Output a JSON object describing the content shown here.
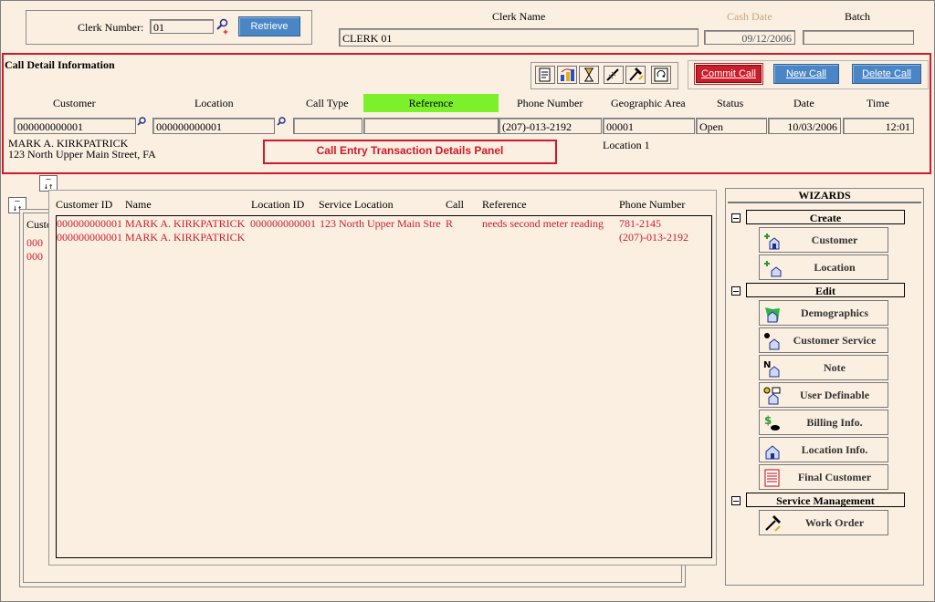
{
  "clerk": {
    "number_label": "Clerk Number:",
    "number_value": "01",
    "retrieve_label": "Retrieve",
    "name_label": "Clerk Name",
    "name_value": "CLERK 01",
    "cash_date_label": "Cash Date",
    "cash_date_value": "09/12/2006",
    "batch_label": "Batch",
    "batch_value": ""
  },
  "call_detail": {
    "title": "Call Detail Information",
    "commit_label": "Commit Call",
    "new_label": "New Call",
    "delete_label": "Delete Call",
    "headers": {
      "customer": "Customer",
      "location": "Location",
      "call_type": "Call Type",
      "reference": "Reference",
      "phone": "Phone Number",
      "geo_area": "Geographic Area",
      "status": "Status",
      "date": "Date",
      "time": "Time"
    },
    "values": {
      "customer": "000000000001",
      "location": "000000000001",
      "call_type": "",
      "reference": "",
      "phone": "(207)-013-2192",
      "geo_area": "00001",
      "status": "Open",
      "date": "10/03/2006",
      "time": "12:01"
    },
    "customer_name": "MARK A. KIRKPATRICK",
    "customer_address": "123 North Upper Main Street, FA",
    "location_desc": "Location 1",
    "panel_caption": "Call Entry Transaction Details Panel"
  },
  "grid": {
    "headers": [
      "Customer ID",
      "Name",
      "Location ID",
      "Service Location",
      "Call",
      "Reference",
      "Phone Number"
    ],
    "rows": [
      [
        "000000000001",
        "MARK A. KIRKPATRICK",
        "000000000001",
        "123 North Upper Main Stre",
        "R",
        "needs second meter reading",
        "781-2145"
      ],
      [
        "000000000001",
        "MARK A. KIRKPATRICK",
        "",
        "",
        "",
        "",
        "(207)-013-2192"
      ]
    ],
    "back_header": "Custo",
    "back_rows": [
      "000",
      "000"
    ]
  },
  "wizards": {
    "title": "WIZARDS",
    "create_label": "Create",
    "create_items": [
      "Customer",
      "Location"
    ],
    "edit_label": "Edit",
    "edit_items": [
      "Demographics",
      "Customer Service",
      "Note",
      "User Definable",
      "Billing Info.",
      "Location Info.",
      "Final Customer"
    ],
    "service_label": "Service Management",
    "service_items": [
      "Work Order"
    ]
  }
}
